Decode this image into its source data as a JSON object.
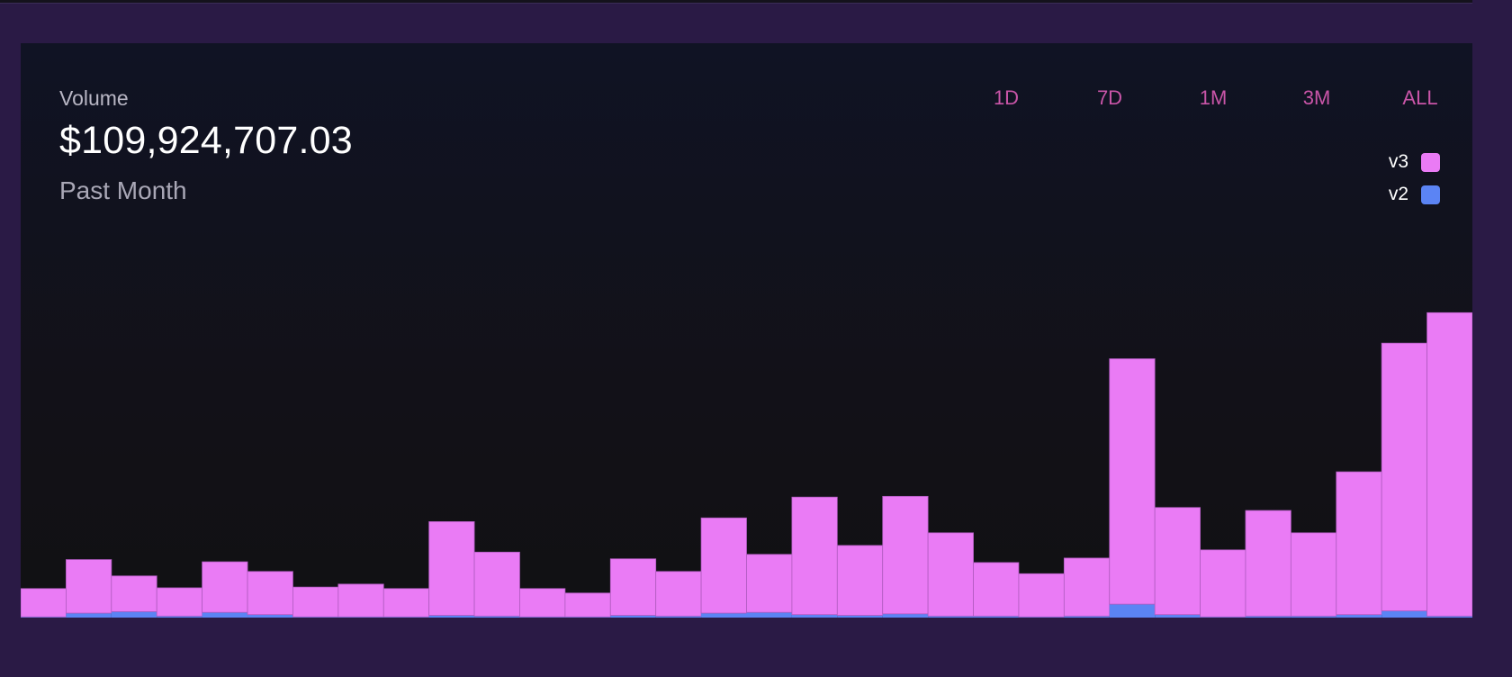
{
  "header": {
    "label": "Volume",
    "value": "$109,924,707.03",
    "period": "Past Month"
  },
  "range_buttons": [
    "1D",
    "7D",
    "1M",
    "3M",
    "ALL"
  ],
  "colors": {
    "v3": "#ea7bf5",
    "v2": "#5b84f4",
    "accent": "#c955a8"
  },
  "chart_data": {
    "type": "bar",
    "stacked": true,
    "categories": [],
    "series": [
      {
        "name": "v3",
        "values": [
          1.9,
          3.6,
          2.4,
          1.9,
          3.4,
          2.9,
          2.0,
          2.2,
          1.9,
          6.3,
          4.3,
          1.9,
          1.6,
          3.8,
          3.0,
          6.4,
          3.9,
          7.9,
          4.7,
          7.9,
          5.6,
          3.6,
          2.9,
          3.9,
          16.5,
          7.2,
          4.5,
          7.1,
          5.6,
          9.6,
          18.0,
          20.4
        ],
        "color": "#ea7bf5"
      },
      {
        "name": "v2",
        "values": [
          0.05,
          0.3,
          0.4,
          0.1,
          0.35,
          0.2,
          0.05,
          0.05,
          0.05,
          0.15,
          0.1,
          0.05,
          0.05,
          0.15,
          0.1,
          0.3,
          0.35,
          0.2,
          0.15,
          0.25,
          0.1,
          0.1,
          0.05,
          0.1,
          0.9,
          0.2,
          0.05,
          0.1,
          0.1,
          0.2,
          0.45,
          0.1
        ],
        "color": "#5b84f4"
      }
    ],
    "ylim": [
      0,
      23
    ],
    "grid": false,
    "legend": "top-right"
  }
}
